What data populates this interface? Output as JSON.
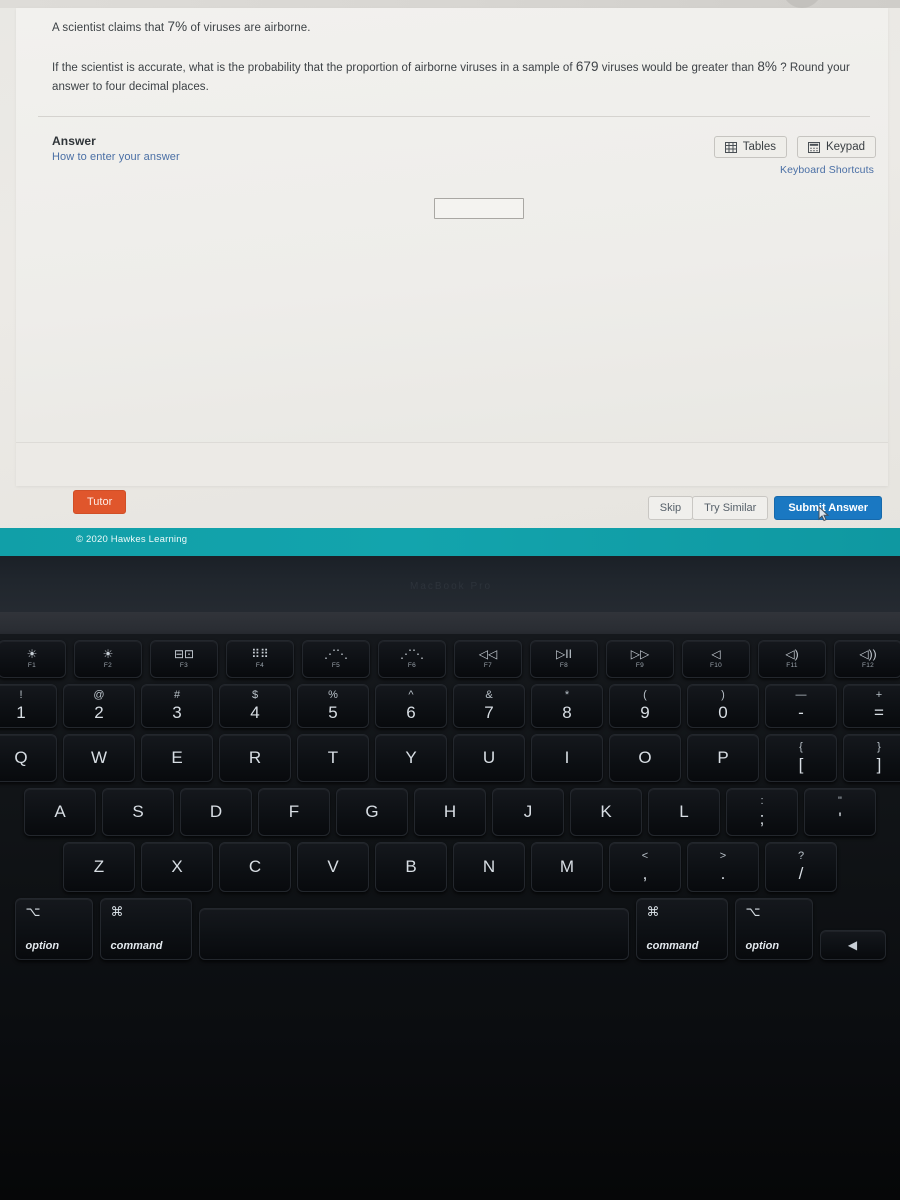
{
  "screen": {
    "question": {
      "line1_prefix": "A scientist claims that ",
      "line1_value": "7",
      "line1_mid": "%",
      "line1_suffix": " of viruses are airborne.",
      "para_part1": "If the scientist is accurate, what is the probability that the proportion of airborne viruses in a sample of ",
      "para_n": "679",
      "para_part2": " viruses would be greater than ",
      "para_pct": "8",
      "para_pct_sym": "%",
      "para_part3": " ? Round your answer to four decimal places."
    },
    "answer": {
      "title": "Answer",
      "help_link": "How to enter your answer",
      "input_value": "",
      "input_placeholder": ""
    },
    "tools": {
      "tables_label": "Tables",
      "tables_icon": "table-grid-icon",
      "keypad_label": "Keypad",
      "keypad_icon": "calculator-keypad-icon",
      "shortcuts_link": "Keyboard Shortcuts"
    },
    "actions": {
      "tutor": "Tutor",
      "skip": "Skip",
      "try_similar": "Try Similar",
      "submit": "Submit Answer"
    },
    "footer": {
      "copyright": "© 2020 Hawkes Learning"
    },
    "colors": {
      "tutor_orange": "#e0562c",
      "submit_blue": "#1a78c2",
      "link_blue": "#4a6fa5",
      "footer_teal": "#13a4ad"
    }
  },
  "laptop": {
    "brand_text": "MacBook Pro",
    "keyboard": {
      "fn_row": [
        {
          "icon": "brightness-low-icon",
          "glyph": "☀",
          "label": "F1"
        },
        {
          "icon": "brightness-high-icon",
          "glyph": "☀",
          "label": "F2"
        },
        {
          "icon": "mission-control-icon",
          "glyph": "⊟⊡",
          "label": "F3"
        },
        {
          "icon": "launchpad-grid-icon",
          "glyph": "⠿⠿",
          "label": "F4"
        },
        {
          "icon": "keyboard-backlight-down-icon",
          "glyph": "⋰⋱",
          "label": "F5"
        },
        {
          "icon": "keyboard-backlight-up-icon",
          "glyph": "⋰⋱",
          "label": "F6"
        },
        {
          "icon": "rewind-icon",
          "glyph": "◁◁",
          "label": "F7"
        },
        {
          "icon": "play-pause-icon",
          "glyph": "▷II",
          "label": "F8"
        },
        {
          "icon": "fast-forward-icon",
          "glyph": "▷▷",
          "label": "F9"
        },
        {
          "icon": "mute-icon",
          "glyph": "◁",
          "label": "F10"
        },
        {
          "icon": "volume-down-icon",
          "glyph": "◁)",
          "label": "F11"
        },
        {
          "icon": "volume-up-icon",
          "glyph": "◁))",
          "label": "F12"
        }
      ],
      "number_row": [
        {
          "top": "!",
          "main": "1"
        },
        {
          "top": "@",
          "main": "2"
        },
        {
          "top": "#",
          "main": "3"
        },
        {
          "top": "$",
          "main": "4"
        },
        {
          "top": "%",
          "main": "5"
        },
        {
          "top": "^",
          "main": "6"
        },
        {
          "top": "&",
          "main": "7"
        },
        {
          "top": "*",
          "main": "8"
        },
        {
          "top": "(",
          "main": "9"
        },
        {
          "top": ")",
          "main": "0"
        },
        {
          "top": "—",
          "main": "-"
        },
        {
          "top": "+",
          "main": "="
        }
      ],
      "q_row": [
        {
          "main": "Q"
        },
        {
          "main": "W"
        },
        {
          "main": "E"
        },
        {
          "main": "R"
        },
        {
          "main": "T"
        },
        {
          "main": "Y"
        },
        {
          "main": "U"
        },
        {
          "main": "I"
        },
        {
          "main": "O"
        },
        {
          "main": "P"
        },
        {
          "top": "{",
          "main": "["
        },
        {
          "top": "}",
          "main": "]"
        }
      ],
      "a_row": [
        {
          "main": "A"
        },
        {
          "main": "S"
        },
        {
          "main": "D"
        },
        {
          "main": "F"
        },
        {
          "main": "G"
        },
        {
          "main": "H"
        },
        {
          "main": "J"
        },
        {
          "main": "K"
        },
        {
          "main": "L"
        },
        {
          "top": ":",
          "main": ";"
        },
        {
          "top": "\"",
          "main": "'"
        }
      ],
      "z_row": [
        {
          "main": "Z"
        },
        {
          "main": "X"
        },
        {
          "main": "C"
        },
        {
          "main": "V"
        },
        {
          "main": "B"
        },
        {
          "main": "N"
        },
        {
          "main": "M"
        },
        {
          "top": "<",
          "main": ","
        },
        {
          "top": ">",
          "main": "."
        },
        {
          "top": "?",
          "main": "/"
        }
      ],
      "mod_row": {
        "option_left_sym": "⌥",
        "option_left_label": "option",
        "command_left_sym": "⌘",
        "command_left_label": "command",
        "space": "",
        "command_right_sym": "⌘",
        "command_right_label": "command",
        "option_right_sym": "⌥",
        "option_right_label": "option",
        "arrow_left": "◀"
      }
    }
  }
}
